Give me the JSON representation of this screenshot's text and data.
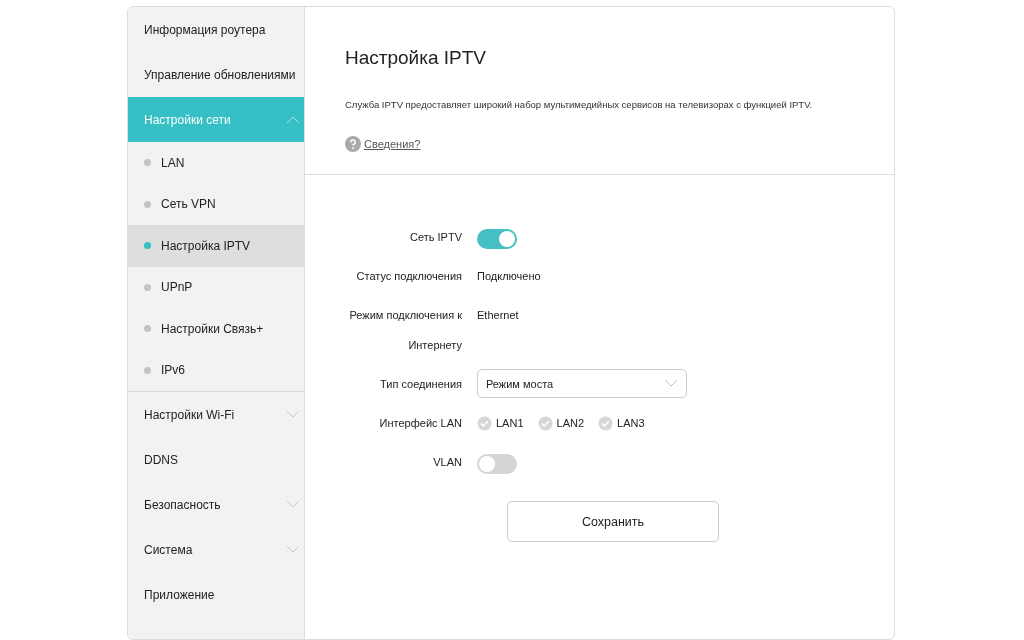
{
  "sidebar": {
    "items": [
      {
        "label": "Информация роутера",
        "kind": "link",
        "selected": false
      },
      {
        "label": "Управление обновлениями",
        "kind": "link",
        "selected": false
      },
      {
        "label": "Настройки сети",
        "kind": "group",
        "selected": true,
        "expanded": true,
        "children": [
          {
            "label": "LAN",
            "selected": false
          },
          {
            "label": "Сеть VPN",
            "selected": false
          },
          {
            "label": "Настройка IPTV",
            "selected": true
          },
          {
            "label": "UPnP",
            "selected": false
          },
          {
            "label": "Настройки Связь+",
            "selected": false
          },
          {
            "label": "IPv6",
            "selected": false
          }
        ]
      },
      {
        "label": "Настройки Wi-Fi",
        "kind": "group",
        "selected": false,
        "expanded": false
      },
      {
        "label": "DDNS",
        "kind": "link",
        "selected": false
      },
      {
        "label": "Безопасность",
        "kind": "group",
        "selected": false,
        "expanded": false
      },
      {
        "label": "Система",
        "kind": "group",
        "selected": false,
        "expanded": false
      },
      {
        "label": "Приложение",
        "kind": "link",
        "selected": false
      }
    ]
  },
  "header": {
    "title": "Настройка IPTV",
    "description": "Служба IPTV предоставляет широкий набор мультимедийных сервисов на телевизорах с функцией IPTV.",
    "help_link": "Сведения?"
  },
  "form": {
    "rows": [
      {
        "kind": "toggle",
        "label": "Сеть IPTV",
        "on": true
      },
      {
        "kind": "text",
        "label": "Статус подключения",
        "value": "Подключено"
      },
      {
        "kind": "text",
        "label": "Режим подключения к Интернету",
        "value": "Ethernet"
      },
      {
        "kind": "select",
        "label": "Тип соединения",
        "value": "Режим моста"
      },
      {
        "kind": "checkboxes",
        "label": "Интерфейс LAN",
        "options": [
          {
            "label": "LAN1",
            "checked": true,
            "disabled": true
          },
          {
            "label": "LAN2",
            "checked": true,
            "disabled": true
          },
          {
            "label": "LAN3",
            "checked": true,
            "disabled": true
          }
        ]
      },
      {
        "kind": "toggle",
        "label": "VLAN",
        "on": false
      }
    ],
    "save_button": "Сохранить"
  }
}
